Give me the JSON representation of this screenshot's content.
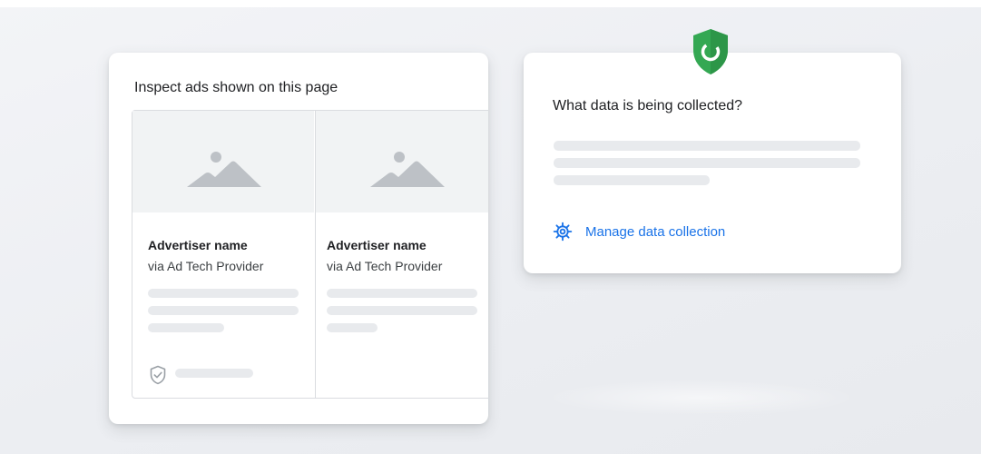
{
  "ads_panel": {
    "title": "Inspect ads shown on this page",
    "ads": [
      {
        "advertiser_name": "Advertiser name",
        "provider": "via Ad Tech Provider"
      },
      {
        "advertiser_name": "Advertiser name",
        "provider": "via Ad Tech Provider"
      }
    ]
  },
  "data_panel": {
    "title": "What data is being collected?",
    "manage_link_label": "Manage data collection"
  },
  "colors": {
    "link_blue": "#1a73e8",
    "shield_green": "#34a853",
    "placeholder_gray": "#e8eaed",
    "image_icon_gray": "#bdc1c6"
  },
  "icons": {
    "ad_image": "image-placeholder-icon",
    "verified": "shield-check-icon",
    "settings": "gear-icon",
    "badge": "green-shield-icon"
  }
}
